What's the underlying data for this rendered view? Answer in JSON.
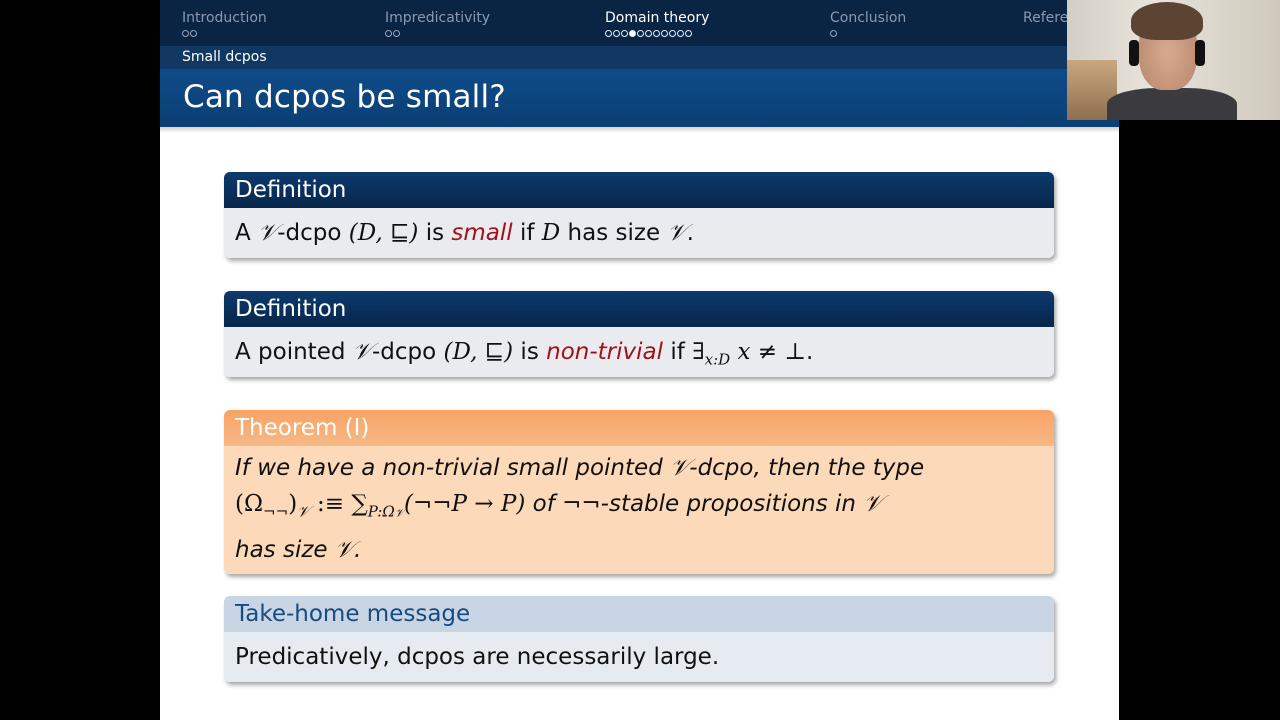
{
  "nav": {
    "sections": [
      {
        "label": "Introduction",
        "dots": [
          0,
          0
        ],
        "active": false
      },
      {
        "label": "Impredicativity",
        "dots": [
          0,
          0
        ],
        "active": false
      },
      {
        "label": "Domain theory",
        "dots": [
          0,
          0,
          0,
          1,
          0,
          0,
          0,
          0,
          0,
          0,
          0
        ],
        "active": true
      },
      {
        "label": "Conclusion",
        "dots": [
          0
        ],
        "active": false
      },
      {
        "label": "Refere",
        "dots": [],
        "active": false
      }
    ]
  },
  "subsection": "Small dcpos",
  "title": "Can dcpos be small?",
  "blocks": {
    "def1": {
      "heading": "Definition",
      "a": "A ",
      "calV": "𝒱",
      "dcpo": "-dcpo ",
      "pair": "(D, ⊑)",
      "is": " is ",
      "small": "small",
      "if": " if ",
      "D": "D",
      "hassize": " has size ",
      "end": "."
    },
    "def2": {
      "heading": "Definition",
      "a": "A pointed ",
      "dcpo": "-dcpo ",
      "pair": "(D, ⊑)",
      "is": " is ",
      "nontrivial": "non-trivial",
      "if": " if ",
      "exists": "∃",
      "sub": "x:D",
      "rest": " x ≠ ⊥",
      "end": "."
    },
    "thm": {
      "heading": "Theorem (I)",
      "line1a": "If we have a non-trivial small pointed ",
      "line1b": "-dcpo, then the type",
      "omega": "(Ω",
      "negneg": "¬¬",
      "close": ")",
      "defeq": " :≡ ",
      "sum": "∑",
      "sumsub": "P:Ω",
      "body": "(¬¬P → P)",
      "of": " of ¬¬-stable propositions in ",
      "line3": "has size ",
      "end": "."
    },
    "ex": {
      "heading": "Take-home message",
      "body": "Predicatively, dcpos are necessarily large."
    }
  },
  "colors": {
    "nav_bg": "#0a2444",
    "title_bg": "#0f4b88",
    "highlight": "#a3101a",
    "theorem_head": "#f9a365",
    "theorem_body": "#fcd9b8",
    "example_head_text": "#174a80"
  }
}
